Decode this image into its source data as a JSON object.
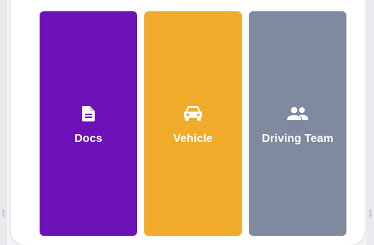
{
  "tiles": [
    {
      "label": "Docs",
      "icon": "document-icon",
      "color": "#6c12b8"
    },
    {
      "label": "Vehicle",
      "icon": "car-icon",
      "color": "#efab29"
    },
    {
      "label": "Driving Team",
      "icon": "people-icon",
      "color": "#7f8a9e"
    }
  ]
}
